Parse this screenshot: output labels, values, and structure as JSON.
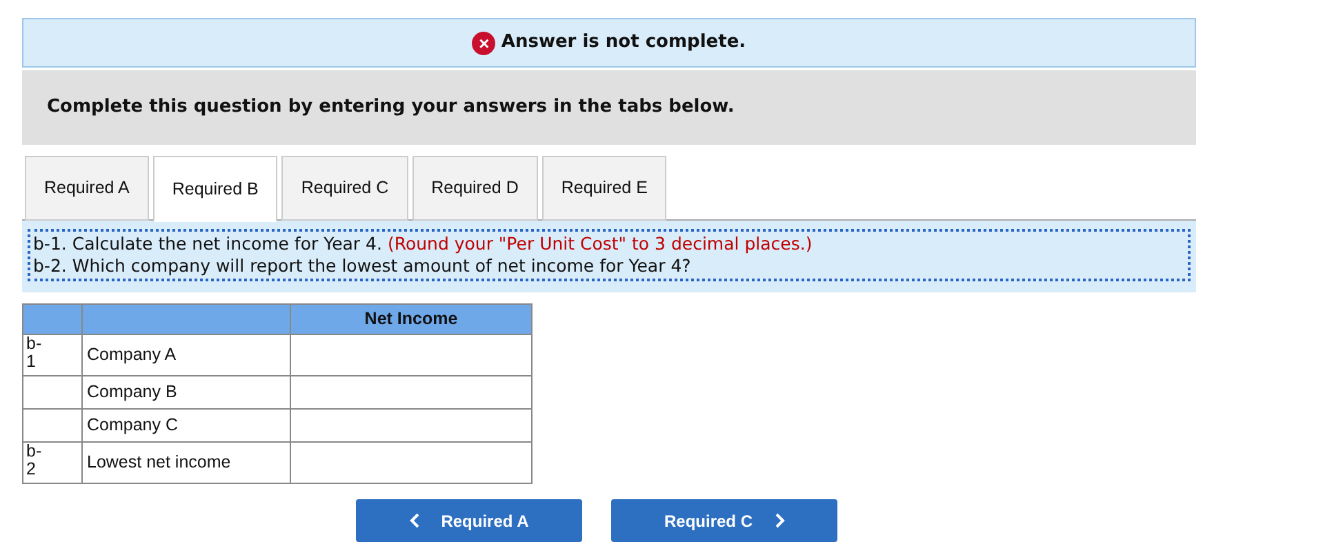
{
  "alert": {
    "icon": "×",
    "message": "Answer is not complete."
  },
  "prompt": "Complete this question by entering your answers in the tabs below.",
  "tabs": [
    {
      "label": "Required A",
      "selected": false
    },
    {
      "label": "Required B",
      "selected": true
    },
    {
      "label": "Required C",
      "selected": false
    },
    {
      "label": "Required D",
      "selected": false
    },
    {
      "label": "Required E",
      "selected": false
    }
  ],
  "instructions": [
    {
      "text": "b-1. Calculate the net income for Year 4.",
      "note": "(Round your \"Per Unit Cost\" to 3 decimal places.)"
    },
    {
      "text": "b-2. Which company will report the lowest amount of net income for Year 4?"
    }
  ],
  "table": {
    "columns": [
      "",
      "",
      "Net Income"
    ],
    "rows": [
      {
        "part": "b-\n1",
        "label": "Company A",
        "value": ""
      },
      {
        "part": "",
        "label": "Company B",
        "value": ""
      },
      {
        "part": "",
        "label": "Company C",
        "value": ""
      },
      {
        "part": "b-\n2",
        "label": "Lowest net income",
        "value": ""
      }
    ]
  },
  "nav": [
    {
      "kind": "prev",
      "label": "Required A"
    },
    {
      "kind": "next",
      "label": "Required C"
    }
  ]
}
